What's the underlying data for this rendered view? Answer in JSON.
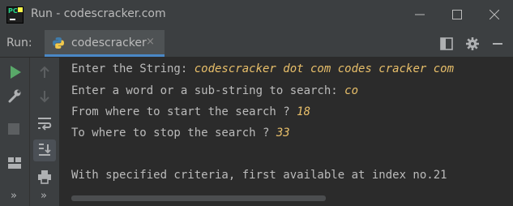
{
  "window": {
    "title": "Run - codescracker.com"
  },
  "toolbar": {
    "run_label": "Run:",
    "tab_label": "codescracker",
    "tab_close": "×"
  },
  "sidebar": {
    "more_label_left": "»",
    "more_label_right": "»"
  },
  "console": {
    "lines": [
      {
        "prompt": "Enter the String: ",
        "input": "codescracker dot com codes cracker com"
      },
      {
        "prompt": "Enter a word or a sub-string to search: ",
        "input": "co"
      },
      {
        "prompt": "From where to start the search ? ",
        "input": "18"
      },
      {
        "prompt": "To where to stop the search ? ",
        "input": "33"
      },
      {
        "prompt": "",
        "input": ""
      },
      {
        "prompt": "With specified criteria, first available at index no.21",
        "input": ""
      }
    ]
  },
  "colors": {
    "background": "#2b2b2b",
    "panel": "#3c3f41",
    "text": "#bbbbbb",
    "user_input": "#e8bf6a",
    "run_green": "#59a869",
    "tab_accent": "#4a88c7"
  },
  "icons": [
    "pycharm-logo-icon",
    "minimize-icon",
    "maximize-icon",
    "close-icon",
    "python-file-icon",
    "layout-icon",
    "gear-icon",
    "hide-icon",
    "rerun-icon",
    "wrench-icon",
    "stop-icon",
    "layout-grid-icon",
    "scroll-up-icon",
    "scroll-down-icon",
    "soft-wrap-icon",
    "scroll-to-end-icon",
    "print-icon"
  ]
}
